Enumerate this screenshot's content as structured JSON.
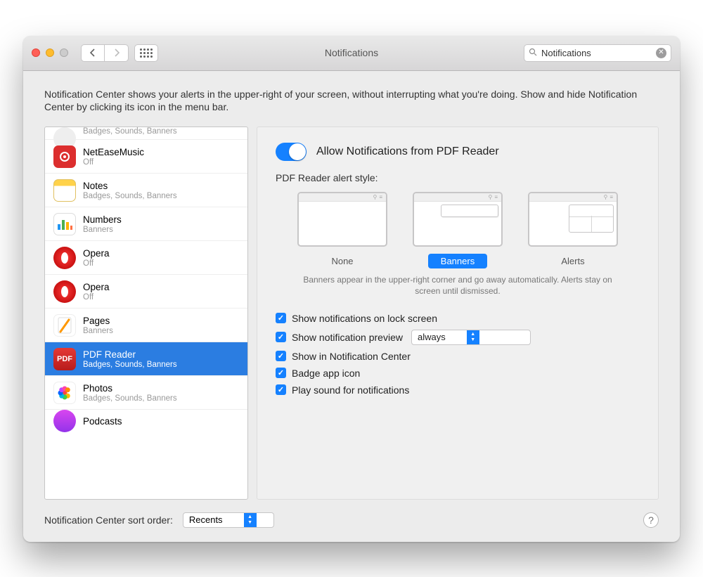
{
  "titlebar": {
    "title": "Notifications"
  },
  "search": {
    "value": "Notifications"
  },
  "intro": "Notification Center shows your alerts in the upper-right of your screen, without interrupting what you're doing. Show and hide Notification Center by clicking its icon in the menu bar.",
  "sidebar": {
    "partial_top_sub": "Badges, Sounds, Banners",
    "items": [
      {
        "name": "NetEaseMusic",
        "sub": "Off",
        "icon": "ic-netease"
      },
      {
        "name": "Notes",
        "sub": "Badges, Sounds, Banners",
        "icon": "ic-notes"
      },
      {
        "name": "Numbers",
        "sub": "Banners",
        "icon": "ic-numbers"
      },
      {
        "name": "Opera",
        "sub": "Off",
        "icon": "ic-opera"
      },
      {
        "name": "Opera",
        "sub": "Off",
        "icon": "ic-opera2"
      },
      {
        "name": "Pages",
        "sub": "Banners",
        "icon": "ic-pages"
      },
      {
        "name": "PDF Reader",
        "sub": "Badges, Sounds, Banners",
        "icon": "ic-pdf",
        "selected": true
      },
      {
        "name": "Photos",
        "sub": "Badges, Sounds, Banners",
        "icon": "ic-photos"
      }
    ],
    "partial_bottom_name": "Podcasts"
  },
  "main": {
    "allow_label": "Allow Notifications from PDF Reader",
    "style_label": "PDF Reader alert style:",
    "styles": {
      "none": "None",
      "banners": "Banners",
      "alerts": "Alerts"
    },
    "style_desc": "Banners appear in the upper-right corner and go away automatically. Alerts stay on screen until dismissed.",
    "checks": {
      "lock": "Show notifications on lock screen",
      "preview": "Show notification preview",
      "preview_value": "always",
      "center": "Show in Notification Center",
      "badge": "Badge app icon",
      "sound": "Play sound for notifications"
    }
  },
  "bottom": {
    "label": "Notification Center sort order:",
    "value": "Recents"
  }
}
